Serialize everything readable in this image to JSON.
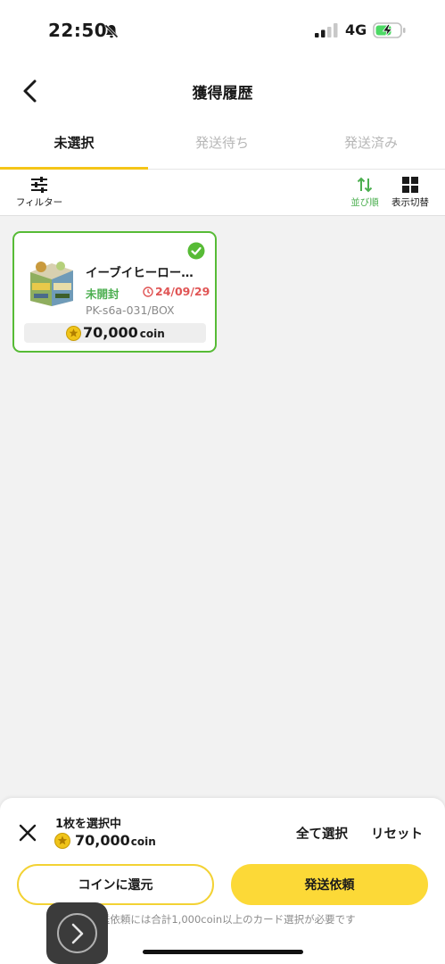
{
  "status_bar": {
    "time": "22:50",
    "network": "4G"
  },
  "nav": {
    "title": "獲得履歴"
  },
  "tabs": [
    {
      "label": "未選択",
      "active": true
    },
    {
      "label": "発送待ち",
      "active": false
    },
    {
      "label": "発送済み",
      "active": false
    }
  ],
  "toolbar": {
    "filter_label": "フィルター",
    "sort_label": "並び順",
    "view_label": "表示切替"
  },
  "items": [
    {
      "name": "イーブイヒーロー…",
      "status": "未開封",
      "date": "24/09/29",
      "code": "PK-s6a-031/BOX",
      "price": "70,000",
      "unit": "coin",
      "selected": true
    }
  ],
  "selection": {
    "count_text": "1枚を選択中",
    "total": "70,000",
    "unit": "coin",
    "select_all_label": "全て選択",
    "reset_label": "リセット",
    "convert_label": "コインに還元",
    "ship_label": "発送依頼",
    "notice": "発送依頼には合計1,000coin以上のカード選択が必要です"
  },
  "colors": {
    "accent_yellow": "#f5c518",
    "button_yellow": "#fcd937",
    "selected_green": "#57bb36",
    "date_red": "#e05555"
  }
}
